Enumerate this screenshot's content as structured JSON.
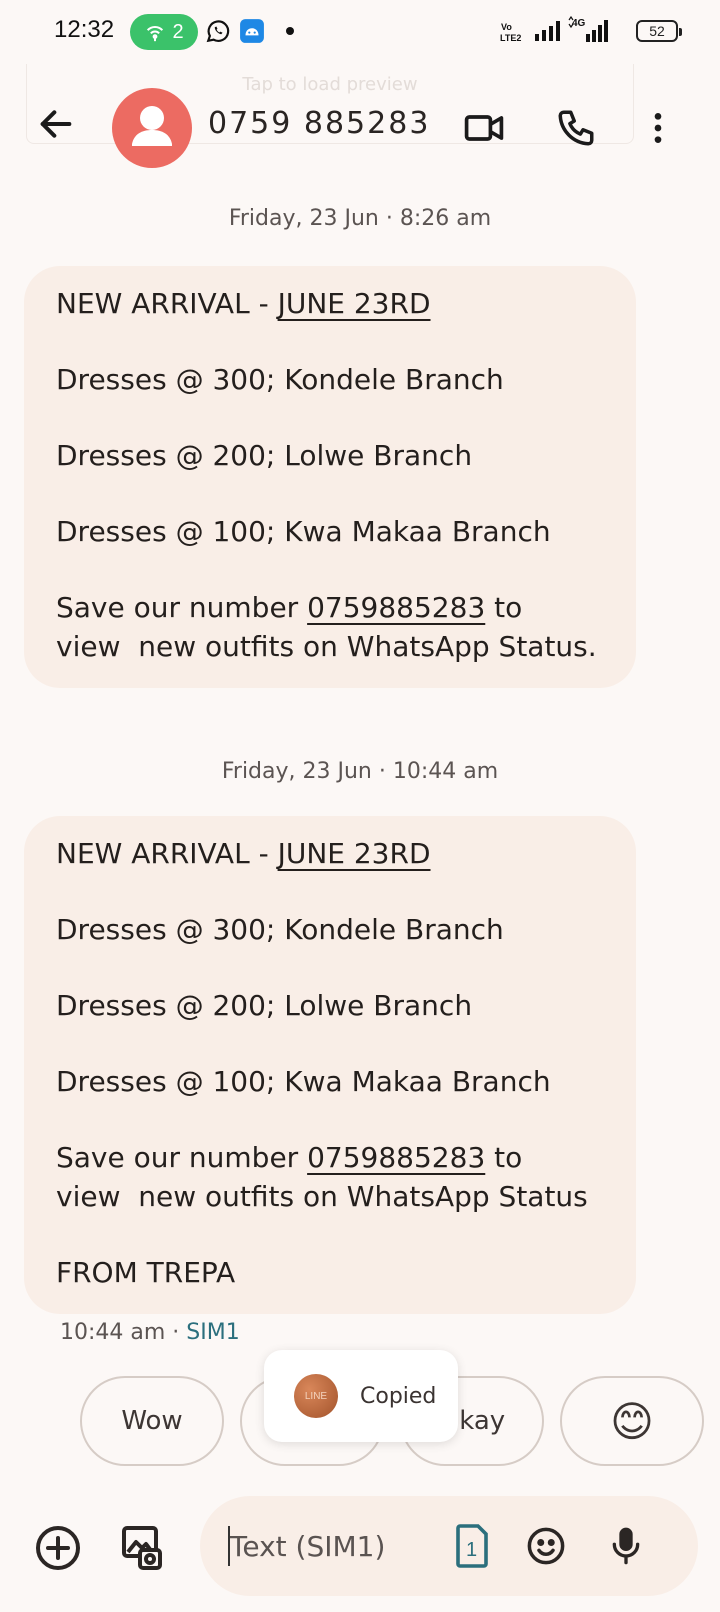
{
  "status_bar": {
    "time": "12:32",
    "hotspot_count": "2",
    "network": "4G",
    "volte": "Vo LTE2",
    "battery": "52",
    "icons": [
      "hotspot-icon",
      "whatsapp-icon",
      "app-notification-icon",
      "dot-icon",
      "volte-icon",
      "signal-icon",
      "4g-signal-icon",
      "battery-icon"
    ]
  },
  "preview": {
    "text": "Tap to load preview"
  },
  "header": {
    "title": "0759 885283",
    "icons": [
      "back-arrow-icon",
      "contact-avatar-icon",
      "video-call-icon",
      "phone-call-icon",
      "more-options-icon"
    ]
  },
  "messages": [
    {
      "date": "Friday, 23 Jun · 8:26 am",
      "title_prefix": "NEW ARRIVAL - ",
      "title_link": "JUNE 23RD",
      "line1": "Dresses @ 300; Kondele Branch",
      "line2": "Dresses @ 200; Lolwe Branch",
      "line3": "Dresses @ 100; Kwa Makaa Branch",
      "save_prefix": "Save our number ",
      "save_number": "0759885283",
      "save_suffix": " to\nview  new outfits on WhatsApp Status."
    },
    {
      "date": "Friday, 23 Jun · 10:44 am",
      "title_prefix": "NEW ARRIVAL - ",
      "title_link": "JUNE 23RD",
      "line1": "Dresses @ 300; Kondele Branch",
      "line2": "Dresses @ 200; Lolwe Branch",
      "line3": "Dresses @ 100; Kwa Makaa Branch",
      "save_prefix": "Save our number ",
      "save_number": "0759885283",
      "save_suffix": " to\nview  new outfits on WhatsApp Status",
      "signature": "FROM TREPA",
      "meta_time": "10:44 am · ",
      "meta_sim": "SIM1"
    }
  ],
  "smart_replies": [
    "Wow",
    "",
    "Okay",
    "😊"
  ],
  "toast": {
    "icon_text": "LINE",
    "text": "Copied"
  },
  "composer": {
    "placeholder": "Text (SIM1)",
    "sim_badge": "1",
    "icons": [
      "add-icon",
      "gallery-icon",
      "sim-card-icon",
      "emoji-icon",
      "microphone-icon"
    ]
  },
  "colors": {
    "background": "#fcf8f6",
    "bubble": "#f9eee7",
    "avatar": "#ec6b62",
    "hotspot": "#3bc26a",
    "sim_accent": "#2b6f7d"
  }
}
